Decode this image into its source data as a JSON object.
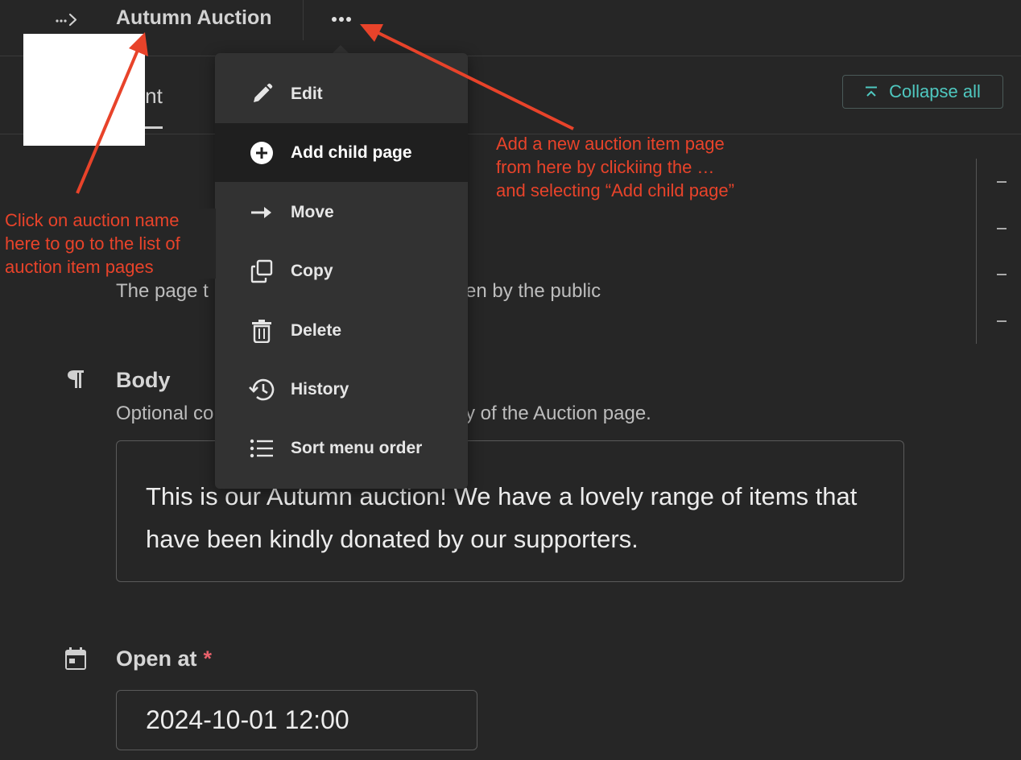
{
  "header": {
    "title": "Autumn Auction",
    "breadcrumb_icon": "breadcrumb-expand-icon",
    "more_icon": "more-horizontal-icon"
  },
  "tabs": {
    "content_label": "ntent"
  },
  "toolbar": {
    "collapse_label": "Collapse all"
  },
  "fields": {
    "promote_help_left": "The page t",
    "promote_help_right": "en by the public",
    "body": {
      "label": "Body",
      "help_left": "Optional co",
      "help_right": "y of the Auction page.",
      "value": "This is our Autumn auction! We have a lovely range of items that have been kindly donated by our supporters."
    },
    "open_at": {
      "label": "Open at",
      "required_mark": "*",
      "value": "2024-10-01 12:00"
    }
  },
  "menu": {
    "items": [
      {
        "label": "Edit",
        "icon": "pencil-icon"
      },
      {
        "label": "Add child page",
        "icon": "plus-circle-icon"
      },
      {
        "label": "Move",
        "icon": "arrow-right-icon"
      },
      {
        "label": "Copy",
        "icon": "copy-icon"
      },
      {
        "label": "Delete",
        "icon": "trash-icon"
      },
      {
        "label": "History",
        "icon": "history-icon"
      },
      {
        "label": "Sort menu order",
        "icon": "list-icon"
      }
    ]
  },
  "annotations": {
    "left": [
      "Click on auction name",
      "here to go to the list of",
      "auction item pages"
    ],
    "right": [
      "Add a new auction item page",
      "from here by clickiing the …",
      "and selecting “Add child page”"
    ]
  },
  "colors": {
    "background": "#262626",
    "menu_bg": "#323232",
    "accent_teal": "#4fc8c0",
    "annotation_red": "#e8432a",
    "required_red": "#e8616b"
  }
}
